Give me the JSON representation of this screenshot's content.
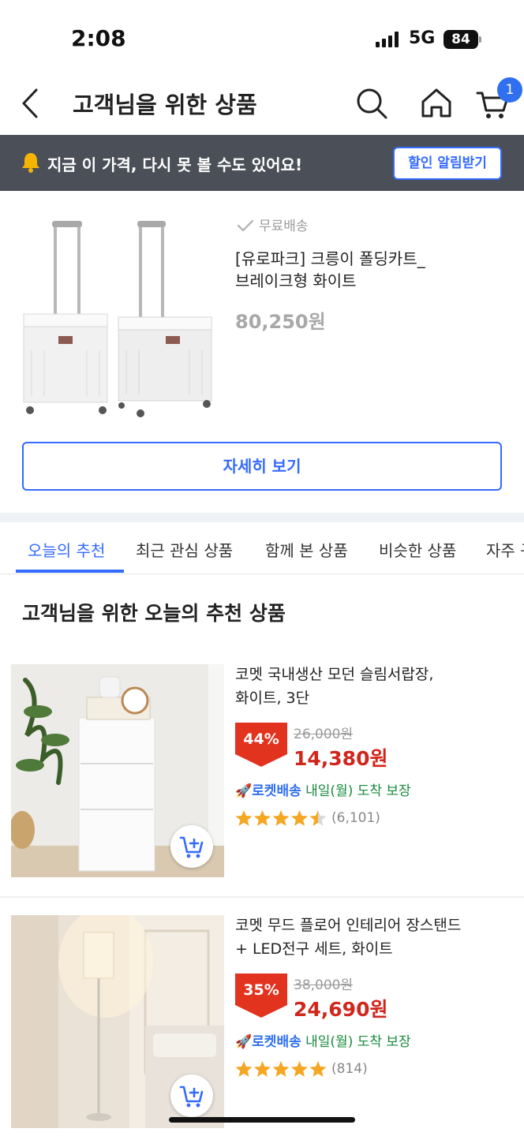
{
  "status_bar": {
    "time": "2:08",
    "network": "5G",
    "battery": "84"
  },
  "header": {
    "title": "고객님을 위한 상품",
    "cart_count": "1"
  },
  "banner": {
    "text": "지금 이 가격, 다시 못 볼 수도 있어요!",
    "button_label": "할인 알림받기"
  },
  "product": {
    "shipping": "무료배송",
    "name_line1": "[유로파크] 크릉이 폴딩카트_",
    "name_line2": "브레이크형 화이트",
    "price": "80,250원",
    "detail_button": "자세히 보기"
  },
  "tabs": [
    {
      "label": "오늘의 추천",
      "active": true
    },
    {
      "label": "최근 관심 상품"
    },
    {
      "label": "함께 본 상품"
    },
    {
      "label": "비슷한 상품"
    },
    {
      "label": "자주 구"
    }
  ],
  "section_title": "고객님을 위한 오늘의 추천 상품",
  "items": [
    {
      "title_line1": "코멧 국내생산 모던 슬림서랍장,",
      "title_line2": "화이트, 3단",
      "discount": "44%",
      "original_price": "26,000원",
      "sale_price": "14,380원",
      "delivery_brand": "로켓배송",
      "delivery_text": "내일(월) 도착 보장",
      "rating": 4.5,
      "reviews": "(6,101)"
    },
    {
      "title_line1": "코멧 무드 플로어 인테리어 장스탠드",
      "title_line2": "+ LED전구 세트, 화이트",
      "discount": "35%",
      "original_price": "38,000원",
      "sale_price": "24,690원",
      "delivery_brand": "로켓배송",
      "delivery_text": "내일(월) 도착 보장",
      "rating": 5,
      "reviews": "(814)"
    }
  ],
  "colors": {
    "accent": "#346aff",
    "sale": "#d0261c",
    "star": "#f5a623",
    "banner_bg": "#4b5058"
  }
}
